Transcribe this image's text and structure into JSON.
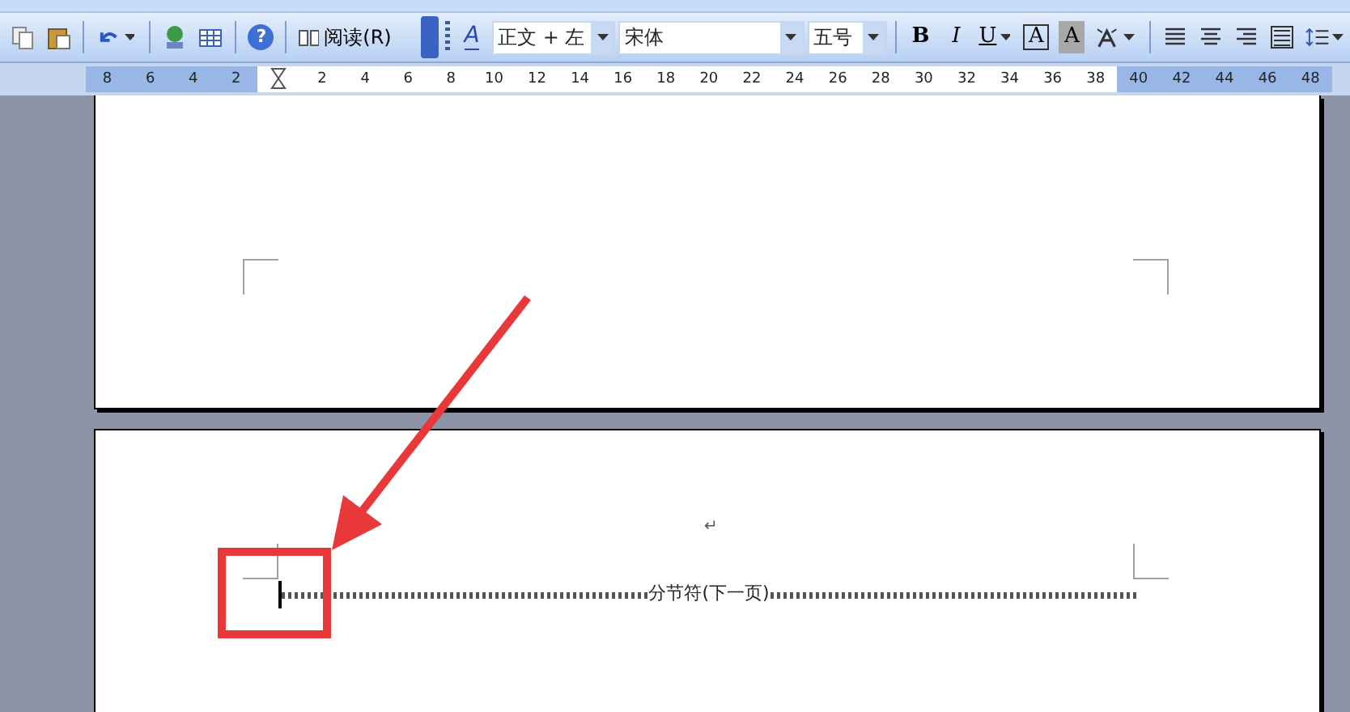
{
  "toolbar": {
    "items": [
      {
        "kind": "copy"
      },
      {
        "kind": "paste"
      },
      {
        "kind": "sep"
      },
      {
        "kind": "undo"
      },
      {
        "kind": "sep"
      },
      {
        "kind": "research"
      },
      {
        "kind": "table"
      },
      {
        "kind": "sep"
      },
      {
        "kind": "help",
        "glyph": "?"
      },
      {
        "kind": "sep"
      },
      {
        "kind": "read",
        "label": "阅读(R)"
      },
      {
        "kind": "overflow"
      },
      {
        "kind": "grip"
      },
      {
        "kind": "styles",
        "glyph": "A"
      },
      {
        "kind": "style-combo",
        "value": "正文 + 左"
      },
      {
        "kind": "font-combo",
        "value": "宋体"
      },
      {
        "kind": "size-combo",
        "value": "五号"
      },
      {
        "kind": "sep"
      },
      {
        "kind": "bold",
        "label": "B"
      },
      {
        "kind": "italic",
        "label": "I"
      },
      {
        "kind": "underline",
        "label": "U"
      },
      {
        "kind": "border",
        "label": "A"
      },
      {
        "kind": "shade",
        "label": "A"
      },
      {
        "kind": "phonetic"
      },
      {
        "kind": "sep"
      },
      {
        "kind": "align-left"
      },
      {
        "kind": "align-center"
      },
      {
        "kind": "align-right"
      },
      {
        "kind": "justify"
      },
      {
        "kind": "line-spacing"
      }
    ]
  },
  "ruler": {
    "left_labels": [
      "8",
      "6",
      "4",
      "2"
    ],
    "right_labels": [
      "2",
      "4",
      "6",
      "8",
      "10",
      "12",
      "14",
      "16",
      "18",
      "20",
      "22",
      "24",
      "26",
      "28",
      "30",
      "32",
      "34",
      "36",
      "38",
      "40",
      "42",
      "44",
      "46",
      "48"
    ]
  },
  "document": {
    "paragraph_mark": "↵",
    "section_break": "分节符(下一页)"
  }
}
